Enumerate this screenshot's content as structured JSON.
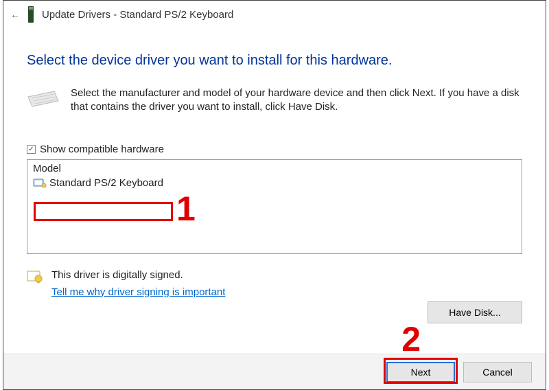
{
  "titlebar": {
    "title": "Update Drivers - Standard PS/2 Keyboard"
  },
  "heading": "Select the device driver you want to install for this hardware.",
  "instruction": "Select the manufacturer and model of your hardware device and then click Next. If you have a disk that contains the driver you want to install, click Have Disk.",
  "checkbox": {
    "label": "Show compatible hardware",
    "checked": true
  },
  "model": {
    "header": "Model",
    "items": [
      "Standard PS/2 Keyboard"
    ]
  },
  "signing": {
    "status": "This driver is digitally signed.",
    "link": "Tell me why driver signing is important"
  },
  "buttons": {
    "have_disk": "Have Disk...",
    "next": "Next",
    "cancel": "Cancel"
  },
  "annotations": {
    "one": "1",
    "two": "2"
  }
}
